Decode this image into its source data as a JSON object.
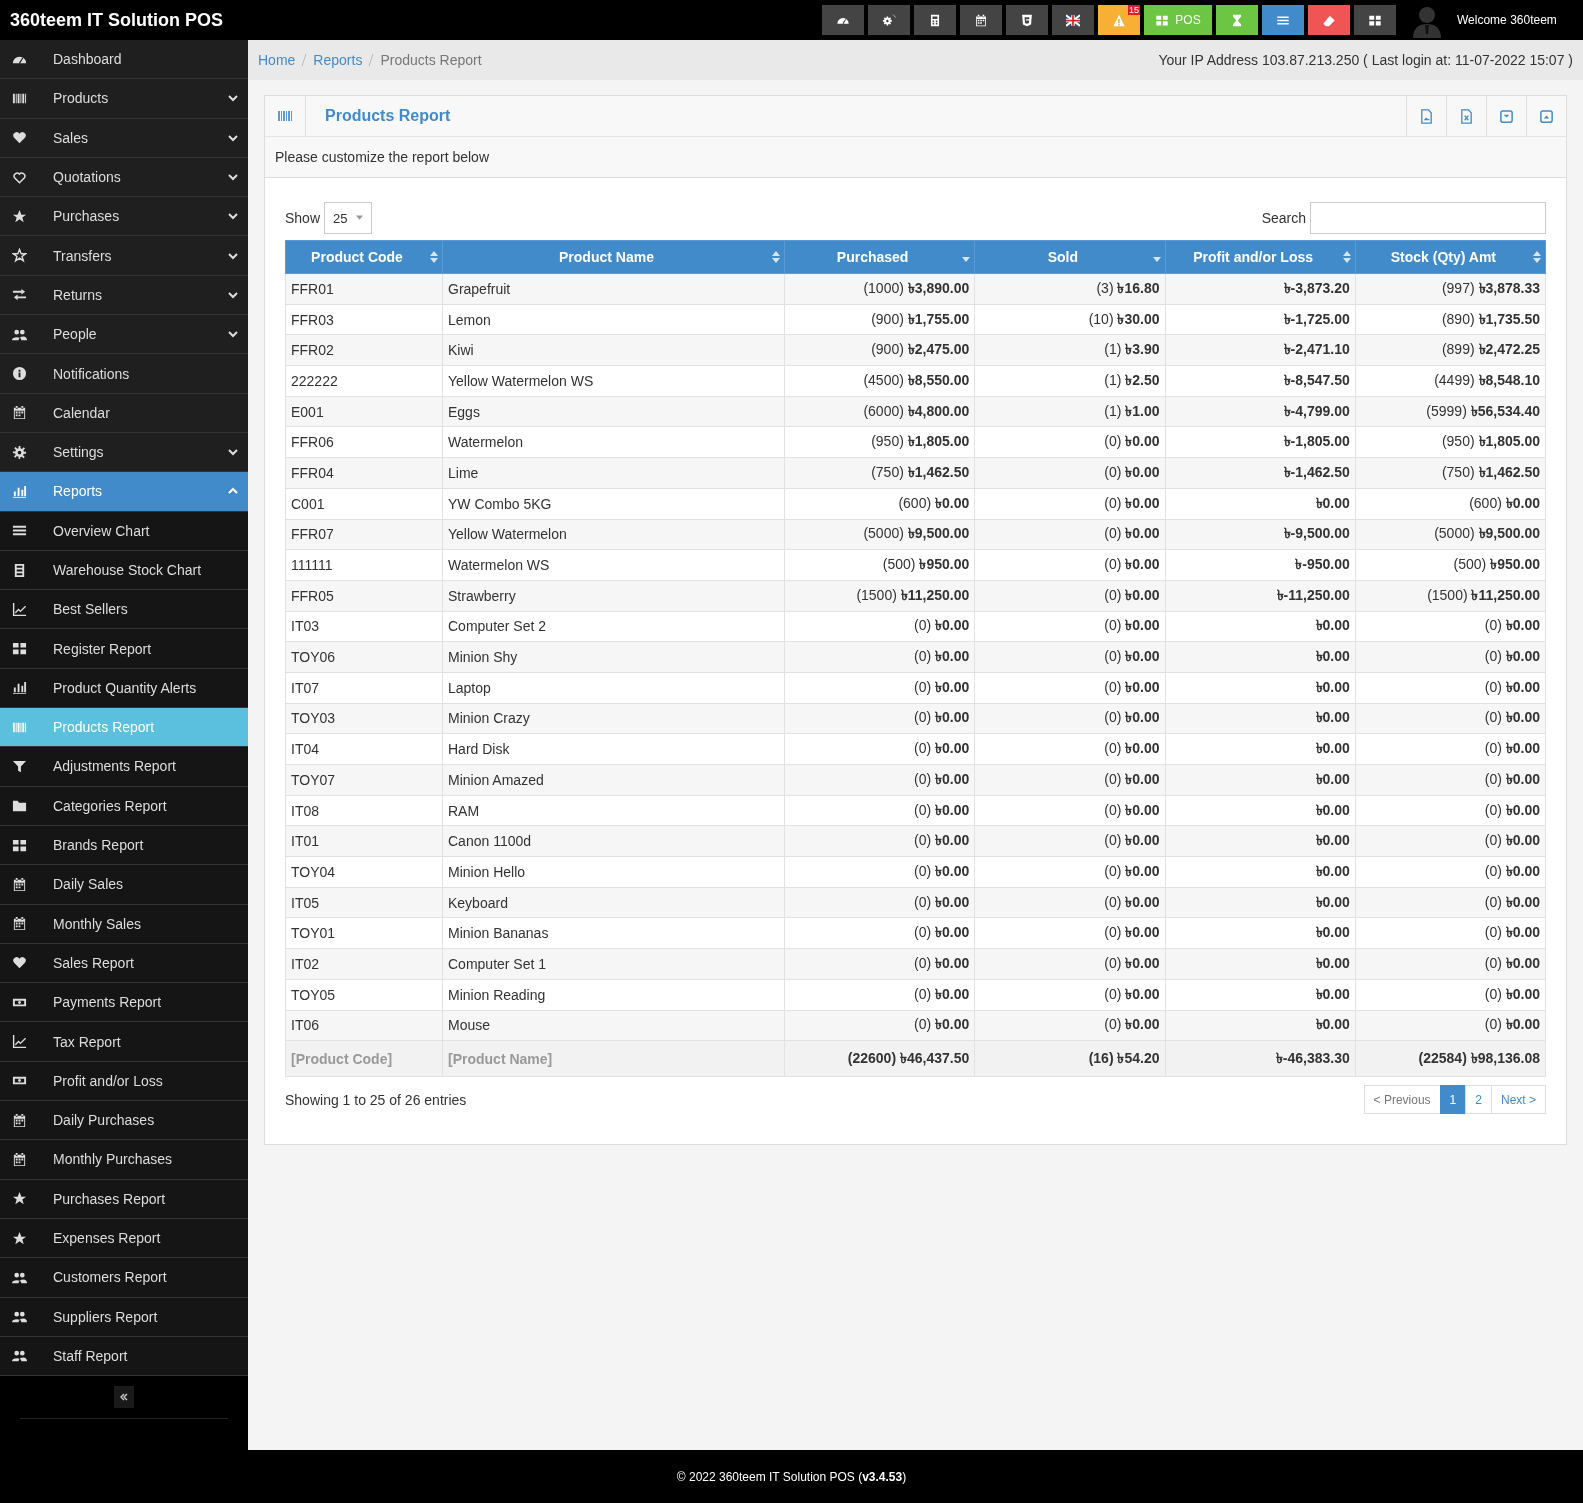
{
  "app": {
    "title": "360teem IT Solution POS",
    "welcome": "Welcome 360teem"
  },
  "top_buttons": [
    {
      "color": "#444444"
    },
    {
      "color": "#444444"
    },
    {
      "color": "#444444"
    },
    {
      "color": "#444444"
    },
    {
      "color": "#444444"
    },
    {
      "color": "#444444"
    },
    {
      "color": "#f8b034",
      "badge": "15"
    },
    {
      "color": "#6cc644",
      "label": "POS"
    },
    {
      "color": "#6cc644"
    },
    {
      "color": "#428bca"
    },
    {
      "color": "#f05454"
    },
    {
      "color": "#444444"
    }
  ],
  "sidebar": {
    "items": [
      {
        "label": "Dashboard",
        "selected": false
      },
      {
        "label": "Products",
        "selected": false,
        "expanded": false
      },
      {
        "label": "Sales",
        "selected": false,
        "expanded": false
      },
      {
        "label": "Quotations",
        "selected": false,
        "expanded": false
      },
      {
        "label": "Purchases",
        "selected": false,
        "expanded": false
      },
      {
        "label": "Transfers",
        "selected": false,
        "expanded": false
      },
      {
        "label": "Returns",
        "selected": false,
        "expanded": false
      },
      {
        "label": "People",
        "selected": false,
        "expanded": false
      },
      {
        "label": "Notifications",
        "selected": false
      },
      {
        "label": "Calendar",
        "selected": false
      },
      {
        "label": "Settings",
        "selected": false,
        "expanded": false
      },
      {
        "label": "Reports",
        "selected": true,
        "expanded": true,
        "children": [
          {
            "label": "Overview Chart",
            "selected": false
          },
          {
            "label": "Warehouse Stock Chart",
            "selected": false
          },
          {
            "label": "Best Sellers",
            "selected": false
          },
          {
            "label": "Register Report",
            "selected": false
          },
          {
            "label": "Product Quantity Alerts",
            "selected": false
          },
          {
            "label": "Products Report",
            "selected": true
          },
          {
            "label": "Adjustments Report",
            "selected": false
          },
          {
            "label": "Categories Report",
            "selected": false
          },
          {
            "label": "Brands Report",
            "selected": false
          },
          {
            "label": "Daily Sales",
            "selected": false
          },
          {
            "label": "Monthly Sales",
            "selected": false
          },
          {
            "label": "Sales Report",
            "selected": false
          },
          {
            "label": "Payments Report",
            "selected": false
          },
          {
            "label": "Tax Report",
            "selected": false
          },
          {
            "label": "Profit and/or Loss",
            "selected": false
          },
          {
            "label": "Daily Purchases",
            "selected": false
          },
          {
            "label": "Monthly Purchases",
            "selected": false
          },
          {
            "label": "Purchases Report",
            "selected": false
          },
          {
            "label": "Expenses Report",
            "selected": false
          },
          {
            "label": "Customers Report",
            "selected": false
          },
          {
            "label": "Suppliers Report",
            "selected": false
          },
          {
            "label": "Staff Report",
            "selected": false
          }
        ]
      }
    ]
  },
  "breadcrumb": [
    "Home",
    "Reports",
    "Products Report"
  ],
  "ip_info": "Your IP Address 103.87.213.250 ( Last login at: 11-07-2022 15:07 )",
  "box": {
    "title": "Products Report",
    "intro": "Please customize the report below"
  },
  "table_controls": {
    "show_label": "Show",
    "page_size": "25",
    "search_label": "Search"
  },
  "table": {
    "columns": [
      {
        "label": "Product Code",
        "sorted": false
      },
      {
        "label": "Product Name",
        "sorted": false
      },
      {
        "label": "Purchased",
        "sorted": true
      },
      {
        "label": "Sold",
        "sorted": true
      },
      {
        "label": "Profit and/or Loss",
        "sorted": false
      },
      {
        "label": "Stock (Qty) Amt",
        "sorted": false
      }
    ],
    "rows": [
      [
        "FFR01",
        "Grapefruit",
        "(1000) **৳3,890.00**",
        "(3) **৳16.80**",
        "৳-3,873.20",
        "(997) **৳3,878.33**"
      ],
      [
        "FFR03",
        "Lemon",
        "(900) **৳1,755.00**",
        "(10) **৳30.00**",
        "৳-1,725.00",
        "(890) **৳1,735.50**"
      ],
      [
        "FFR02",
        "Kiwi",
        "(900) **৳2,475.00**",
        "(1) **৳3.90**",
        "৳-2,471.10",
        "(899) **৳2,472.25**"
      ],
      [
        "222222",
        "Yellow Watermelon WS",
        "(4500) **৳8,550.00**",
        "(1) **৳2.50**",
        "৳-8,547.50",
        "(4499) **৳8,548.10**"
      ],
      [
        "E001",
        "Eggs",
        "(6000) **৳4,800.00**",
        "(1) **৳1.00**",
        "৳-4,799.00",
        "(5999) **৳56,534.40**"
      ],
      [
        "FFR06",
        "Watermelon",
        "(950) **৳1,805.00**",
        "(0) **৳0.00**",
        "৳-1,805.00",
        "(950) **৳1,805.00**"
      ],
      [
        "FFR04",
        "Lime",
        "(750) **৳1,462.50**",
        "(0) **৳0.00**",
        "৳-1,462.50",
        "(750) **৳1,462.50**"
      ],
      [
        "C001",
        "YW Combo 5KG",
        "(600) **৳0.00**",
        "(0) **৳0.00**",
        "৳0.00",
        "(600) **৳0.00**"
      ],
      [
        "FFR07",
        "Yellow Watermelon",
        "(5000) **৳9,500.00**",
        "(0) **৳0.00**",
        "৳-9,500.00",
        "(5000) **৳9,500.00**"
      ],
      [
        "111111",
        "Watermelon WS",
        "(500) **৳950.00**",
        "(0) **৳0.00**",
        "৳-950.00",
        "(500) **৳950.00**"
      ],
      [
        "FFR05",
        "Strawberry",
        "(1500) **৳11,250.00**",
        "(0) **৳0.00**",
        "৳-11,250.00",
        "(1500) **৳11,250.00**"
      ],
      [
        "IT03",
        "Computer Set 2",
        "(0) **৳0.00**",
        "(0) **৳0.00**",
        "৳0.00",
        "(0) **৳0.00**"
      ],
      [
        "TOY06",
        "Minion Shy",
        "(0) **৳0.00**",
        "(0) **৳0.00**",
        "৳0.00",
        "(0) **৳0.00**"
      ],
      [
        "IT07",
        "Laptop",
        "(0) **৳0.00**",
        "(0) **৳0.00**",
        "৳0.00",
        "(0) **৳0.00**"
      ],
      [
        "TOY03",
        "Minion Crazy",
        "(0) **৳0.00**",
        "(0) **৳0.00**",
        "৳0.00",
        "(0) **৳0.00**"
      ],
      [
        "IT04",
        "Hard Disk",
        "(0) **৳0.00**",
        "(0) **৳0.00**",
        "৳0.00",
        "(0) **৳0.00**"
      ],
      [
        "TOY07",
        "Minion Amazed",
        "(0) **৳0.00**",
        "(0) **৳0.00**",
        "৳0.00",
        "(0) **৳0.00**"
      ],
      [
        "IT08",
        "RAM",
        "(0) **৳0.00**",
        "(0) **৳0.00**",
        "৳0.00",
        "(0) **৳0.00**"
      ],
      [
        "IT01",
        "Canon 1100d",
        "(0) **৳0.00**",
        "(0) **৳0.00**",
        "৳0.00",
        "(0) **৳0.00**"
      ],
      [
        "TOY04",
        "Minion Hello",
        "(0) **৳0.00**",
        "(0) **৳0.00**",
        "৳0.00",
        "(0) **৳0.00**"
      ],
      [
        "IT05",
        "Keyboard",
        "(0) **৳0.00**",
        "(0) **৳0.00**",
        "৳0.00",
        "(0) **৳0.00**"
      ],
      [
        "TOY01",
        "Minion Bananas",
        "(0) **৳0.00**",
        "(0) **৳0.00**",
        "৳0.00",
        "(0) **৳0.00**"
      ],
      [
        "IT02",
        "Computer Set 1",
        "(0) **৳0.00**",
        "(0) **৳0.00**",
        "৳0.00",
        "(0) **৳0.00**"
      ],
      [
        "TOY05",
        "Minion Reading",
        "(0) **৳0.00**",
        "(0) **৳0.00**",
        "৳0.00",
        "(0) **৳0.00**"
      ],
      [
        "IT06",
        "Mouse",
        "(0) **৳0.00**",
        "(0) **৳0.00**",
        "৳0.00",
        "(0) **৳0.00**"
      ]
    ],
    "footer_row": [
      "[Product Code]",
      "[Product Name]",
      "(22600) ৳46,437.50",
      "(16) ৳54.20",
      "৳-46,383.30",
      "(22584) ৳98,136.08"
    ]
  },
  "info": "Showing 1 to 25 of 26 entries",
  "pagination": [
    {
      "label": "< Previous",
      "selected": false
    },
    {
      "label": "1",
      "selected": true
    },
    {
      "label": "2",
      "selected": false
    },
    {
      "label": "Next >",
      "selected": false
    }
  ],
  "footer": "© 2022 360teem IT Solution POS (**v3.4.53**)"
}
